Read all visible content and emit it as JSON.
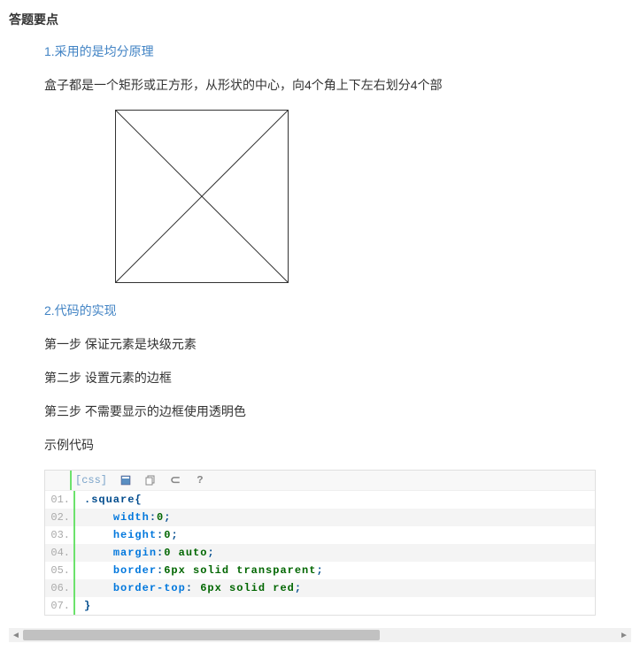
{
  "title": "答题要点",
  "section1": {
    "heading": "1.采用的是均分原理",
    "para": " 盒子都是一个矩形或正方形，从形状的中心，向4个角上下左右划分4个部"
  },
  "section2": {
    "heading": "2.代码的实现",
    "step1": "第一步 保证元素是块级元素",
    "step2": "第二步 设置元素的边框",
    "step3": "第三步 不需要显示的边框使用透明色",
    "example_label": " 示例代码"
  },
  "code": {
    "lang": "[css]",
    "lines": [
      {
        "n": "01.",
        "tokens": [
          {
            "t": ".square",
            "c": "c-sel"
          },
          {
            "t": "{",
            "c": "c-punc"
          }
        ]
      },
      {
        "n": "02.",
        "tokens": [
          {
            "t": "    "
          },
          {
            "t": "width",
            "c": "c-prop"
          },
          {
            "t": ":",
            "c": "c-punc"
          },
          {
            "t": "0",
            "c": "c-val"
          },
          {
            "t": ";",
            "c": "c-punc"
          }
        ]
      },
      {
        "n": "03.",
        "tokens": [
          {
            "t": "    "
          },
          {
            "t": "height",
            "c": "c-prop"
          },
          {
            "t": ":",
            "c": "c-punc"
          },
          {
            "t": "0",
            "c": "c-val"
          },
          {
            "t": ";",
            "c": "c-punc"
          }
        ]
      },
      {
        "n": "04.",
        "tokens": [
          {
            "t": "    "
          },
          {
            "t": "margin",
            "c": "c-prop"
          },
          {
            "t": ":",
            "c": "c-punc"
          },
          {
            "t": "0 auto",
            "c": "c-val"
          },
          {
            "t": ";",
            "c": "c-punc"
          }
        ]
      },
      {
        "n": "05.",
        "tokens": [
          {
            "t": "    "
          },
          {
            "t": "border",
            "c": "c-prop"
          },
          {
            "t": ":",
            "c": "c-punc"
          },
          {
            "t": "6px solid transparent",
            "c": "c-val"
          },
          {
            "t": ";",
            "c": "c-punc"
          }
        ]
      },
      {
        "n": "06.",
        "tokens": [
          {
            "t": "    "
          },
          {
            "t": "border-top",
            "c": "c-prop"
          },
          {
            "t": ": ",
            "c": "c-punc"
          },
          {
            "t": "6px solid red",
            "c": "c-val"
          },
          {
            "t": ";",
            "c": "c-punc"
          }
        ]
      },
      {
        "n": "07.",
        "tokens": [
          {
            "t": "}",
            "c": "c-punc"
          }
        ]
      }
    ]
  }
}
